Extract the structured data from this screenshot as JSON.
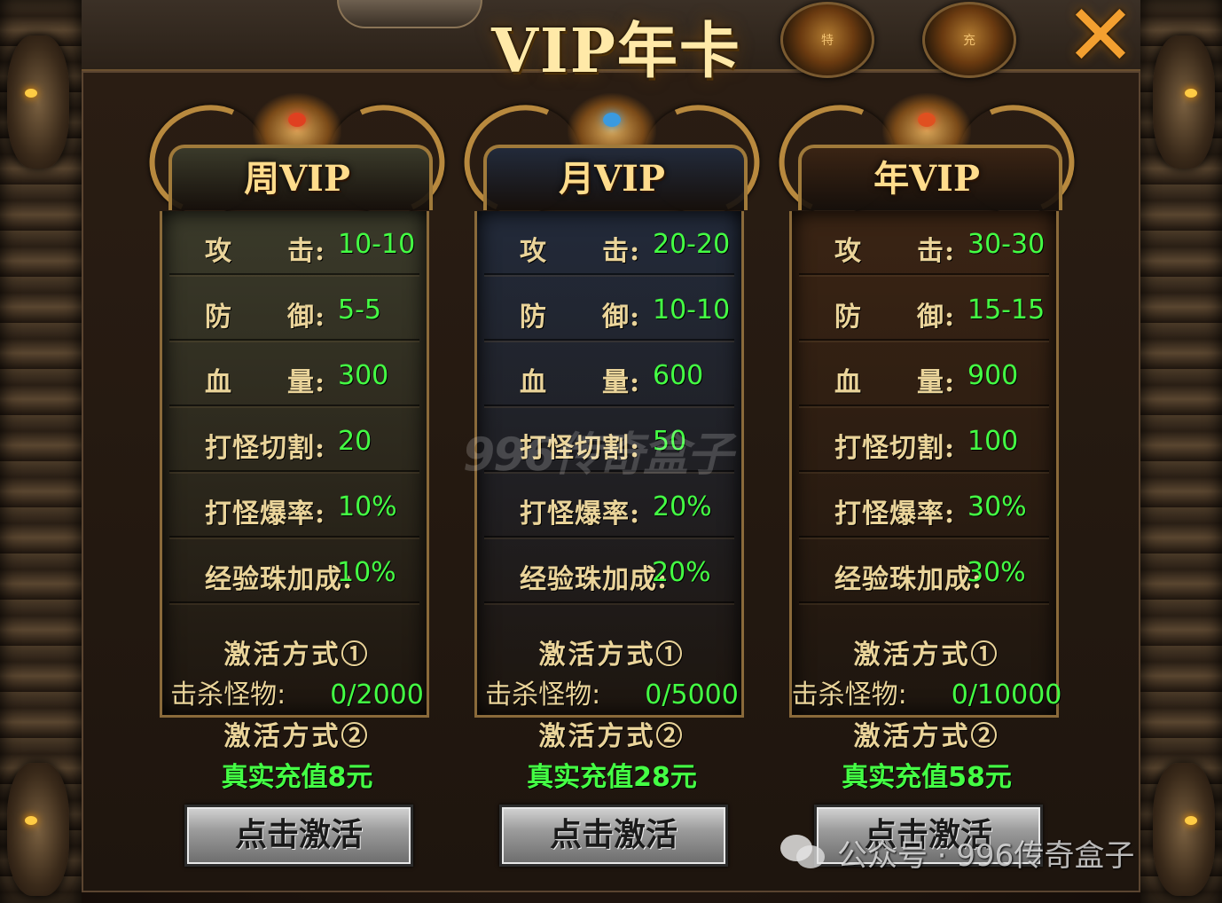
{
  "window": {
    "title": "VIP年卡",
    "close_label": "✕"
  },
  "header_medals": [
    {
      "icon": "crown-medal-icon",
      "text": "特"
    },
    {
      "icon": "money-bag-icon",
      "text": "充"
    }
  ],
  "cards": [
    {
      "name": "周VIP",
      "theme": "#3a3a2a",
      "gem_color": "#e04020",
      "stats": [
        {
          "label": "攻　　击:",
          "value": "10-10"
        },
        {
          "label": "防　　御:",
          "value": "5-5"
        },
        {
          "label": "血　　量:",
          "value": "300"
        },
        {
          "label": "打怪切割:",
          "value": "20"
        },
        {
          "label": "打怪爆率:",
          "value": "10%"
        },
        {
          "label": "经验珠加成:",
          "value": "10%"
        }
      ],
      "method1_label": "激活方式①",
      "kill_label": "击杀怪物:",
      "kill_progress": "0/2000",
      "method2_label": "激活方式②",
      "recharge_text": "真实充值8元",
      "button_label": "点击激活"
    },
    {
      "name": "月VIP",
      "theme": "#222a3a",
      "gem_color": "#3a9ae0",
      "stats": [
        {
          "label": "攻　　击:",
          "value": "20-20"
        },
        {
          "label": "防　　御:",
          "value": "10-10"
        },
        {
          "label": "血　　量:",
          "value": "600"
        },
        {
          "label": "打怪切割:",
          "value": "50"
        },
        {
          "label": "打怪爆率:",
          "value": "20%"
        },
        {
          "label": "经验珠加成:",
          "value": "20%"
        }
      ],
      "method1_label": "激活方式①",
      "kill_label": "击杀怪物:",
      "kill_progress": "0/5000",
      "method2_label": "激活方式②",
      "recharge_text": "真实充值28元",
      "button_label": "点击激活"
    },
    {
      "name": "年VIP",
      "theme": "#3a2414",
      "gem_color": "#e05020",
      "stats": [
        {
          "label": "攻　　击:",
          "value": "30-30"
        },
        {
          "label": "防　　御:",
          "value": "15-15"
        },
        {
          "label": "血　　量:",
          "value": "900"
        },
        {
          "label": "打怪切割:",
          "value": "100"
        },
        {
          "label": "打怪爆率:",
          "value": "30%"
        },
        {
          "label": "经验珠加成:",
          "value": "30%"
        }
      ],
      "method1_label": "激活方式①",
      "kill_label": "击杀怪物:",
      "kill_progress": "0/10000",
      "method2_label": "激活方式②",
      "recharge_text": "真实充值58元",
      "button_label": "点击激活"
    }
  ],
  "watermark_text": "996传奇盒子",
  "footer_mark": {
    "icon": "wechat-icon",
    "text": "公众号 · 996传奇盒子"
  }
}
